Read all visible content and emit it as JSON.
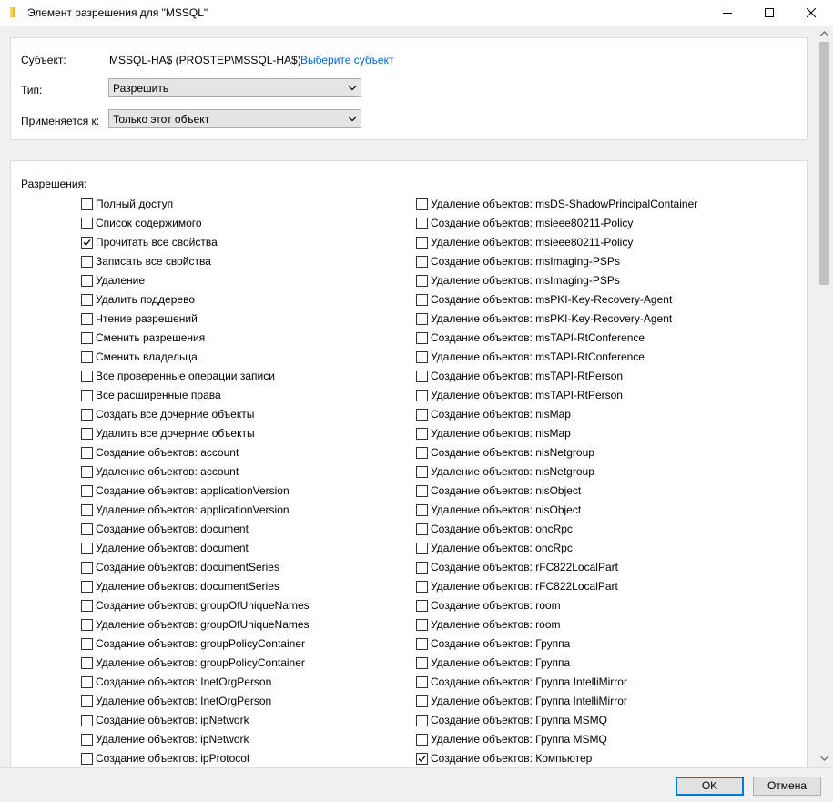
{
  "window": {
    "title": "Элемент разрешения для \"MSSQL\"",
    "icon": "folder-icon"
  },
  "subject": {
    "label": "Субъект:",
    "value": "MSSQL-HA$ (PROSTEP\\MSSQL-HA$)",
    "link": "Выберите субъект"
  },
  "type": {
    "label": "Тип:",
    "value": "Разрешить"
  },
  "applies": {
    "label": "Применяется к:",
    "value": "Только этот объект"
  },
  "permissions": {
    "title": "Разрешения:",
    "left": [
      {
        "label": "Полный доступ",
        "checked": false
      },
      {
        "label": "Список содержимого",
        "checked": false
      },
      {
        "label": "Прочитать все свойства",
        "checked": true
      },
      {
        "label": "Записать все свойства",
        "checked": false
      },
      {
        "label": "Удаление",
        "checked": false
      },
      {
        "label": "Удалить поддерево",
        "checked": false
      },
      {
        "label": "Чтение разрешений",
        "checked": false
      },
      {
        "label": "Сменить разрешения",
        "checked": false
      },
      {
        "label": "Сменить владельца",
        "checked": false
      },
      {
        "label": "Все проверенные операции записи",
        "checked": false
      },
      {
        "label": "Все расширенные права",
        "checked": false
      },
      {
        "label": "Создать все дочерние объекты",
        "checked": false
      },
      {
        "label": "Удалить все дочерние объекты",
        "checked": false
      },
      {
        "label": "Создание объектов: account",
        "checked": false
      },
      {
        "label": "Удаление объектов: account",
        "checked": false
      },
      {
        "label": "Создание объектов: applicationVersion",
        "checked": false
      },
      {
        "label": "Удаление объектов: applicationVersion",
        "checked": false
      },
      {
        "label": "Создание объектов: document",
        "checked": false
      },
      {
        "label": "Удаление объектов: document",
        "checked": false
      },
      {
        "label": "Создание объектов: documentSeries",
        "checked": false
      },
      {
        "label": "Удаление объектов: documentSeries",
        "checked": false
      },
      {
        "label": "Создание объектов: groupOfUniqueNames",
        "checked": false
      },
      {
        "label": "Удаление объектов: groupOfUniqueNames",
        "checked": false
      },
      {
        "label": "Создание объектов: groupPolicyContainer",
        "checked": false
      },
      {
        "label": "Удаление объектов: groupPolicyContainer",
        "checked": false
      },
      {
        "label": "Создание объектов: InetOrgPerson",
        "checked": false
      },
      {
        "label": "Удаление объектов: InetOrgPerson",
        "checked": false
      },
      {
        "label": "Создание объектов: ipNetwork",
        "checked": false
      },
      {
        "label": "Удаление объектов: ipNetwork",
        "checked": false
      },
      {
        "label": "Создание объектов: ipProtocol",
        "checked": false
      }
    ],
    "right": [
      {
        "label": "Удаление объектов: msDS-ShadowPrincipalContainer",
        "checked": false
      },
      {
        "label": "Создание объектов: msieee80211-Policy",
        "checked": false
      },
      {
        "label": "Удаление объектов: msieee80211-Policy",
        "checked": false
      },
      {
        "label": "Создание объектов: msImaging-PSPs",
        "checked": false
      },
      {
        "label": "Удаление объектов: msImaging-PSPs",
        "checked": false
      },
      {
        "label": "Создание объектов: msPKI-Key-Recovery-Agent",
        "checked": false
      },
      {
        "label": "Удаление объектов: msPKI-Key-Recovery-Agent",
        "checked": false
      },
      {
        "label": "Создание объектов: msTAPI-RtConference",
        "checked": false
      },
      {
        "label": "Удаление объектов: msTAPI-RtConference",
        "checked": false
      },
      {
        "label": "Создание объектов: msTAPI-RtPerson",
        "checked": false
      },
      {
        "label": "Удаление объектов: msTAPI-RtPerson",
        "checked": false
      },
      {
        "label": "Создание объектов: nisMap",
        "checked": false
      },
      {
        "label": "Удаление объектов: nisMap",
        "checked": false
      },
      {
        "label": "Создание объектов: nisNetgroup",
        "checked": false
      },
      {
        "label": "Удаление объектов: nisNetgroup",
        "checked": false
      },
      {
        "label": "Создание объектов: nisObject",
        "checked": false
      },
      {
        "label": "Удаление объектов: nisObject",
        "checked": false
      },
      {
        "label": "Создание объектов: oncRpc",
        "checked": false
      },
      {
        "label": "Удаление объектов: oncRpc",
        "checked": false
      },
      {
        "label": "Создание объектов: rFC822LocalPart",
        "checked": false
      },
      {
        "label": "Удаление объектов: rFC822LocalPart",
        "checked": false
      },
      {
        "label": "Создание объектов: room",
        "checked": false
      },
      {
        "label": "Удаление объектов: room",
        "checked": false
      },
      {
        "label": "Создание объектов: Группа",
        "checked": false
      },
      {
        "label": "Удаление объектов: Группа",
        "checked": false
      },
      {
        "label": "Создание объектов: Группа IntelliMirror",
        "checked": false
      },
      {
        "label": "Удаление объектов: Группа IntelliMirror",
        "checked": false
      },
      {
        "label": "Создание объектов: Группа MSMQ",
        "checked": false
      },
      {
        "label": "Удаление объектов: Группа MSMQ",
        "checked": false
      },
      {
        "label": "Создание объектов: Компьютер",
        "checked": true
      }
    ]
  },
  "buttons": {
    "ok": "OK",
    "cancel": "Отмена"
  },
  "colors": {
    "link": "#0066cc",
    "default_button_border": "#0078d7",
    "folder_icon": "#e8b830"
  }
}
